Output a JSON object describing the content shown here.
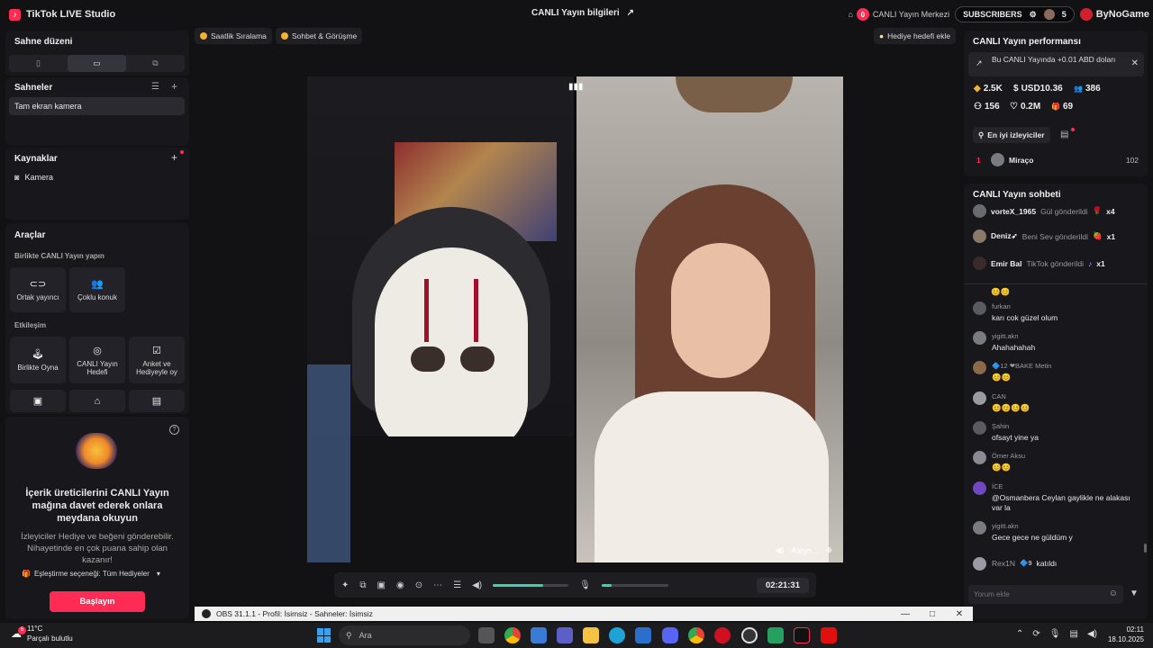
{
  "window": {
    "app_title": "TikTok LIVE Studio",
    "center_title": "CANLI Yayın bilgileri",
    "yayin_merkez": "CANLI Yayın Merkezi",
    "notif_count": "0",
    "subscribers_label": "SUBSCRIBERS",
    "subscribers_count": "5",
    "brand": "ByNoGame"
  },
  "left": {
    "scene_layout_title": "Sahne düzeni",
    "scenes_title": "Sahneler",
    "scene_item": "Tam ekran kamera",
    "sources_title": "Kaynaklar",
    "source_item": "Kamera",
    "tools_title": "Araçlar",
    "collab_title": "Birlikte CANLI Yayın yapın",
    "tools_row1": [
      {
        "icon": "link-icon",
        "glyph": "⊂⊃",
        "label": "Ortak yayıncı"
      },
      {
        "icon": "multi-guest-icon",
        "glyph": "👥",
        "label": "Çoklu konuk"
      }
    ],
    "interaction_title": "Etkileşim",
    "tools_row2": [
      {
        "icon": "joystick-icon",
        "glyph": "🕹",
        "label": "Birlikte Oyna"
      },
      {
        "icon": "goal-icon",
        "glyph": "◎",
        "label": "CANLI Yayın Hedefi"
      },
      {
        "icon": "poll-icon",
        "glyph": "☑",
        "label": "Anket ve Hediyeyle oy"
      }
    ],
    "promo_title": "İçerik üreticilerini CANLI Yayın mağına davet ederek onlara meydana okuyun",
    "promo_text": "İzleyiciler Hediye ve beğeni gönderebilir. Nihayetinde en çok puana sahip olan kazanır!",
    "pairing_label": "Eşleştirme seçeneği: Tüm Hediyeler",
    "start_button": "Başlayın"
  },
  "chips": {
    "hourly": "Saatlik Sıralama",
    "chat_meet": "Sohbet & Görüşme",
    "gift_goal": "Hediye hedefi ekle"
  },
  "video": {
    "right_label": "Aleyn..."
  },
  "controls": {
    "volume_level": 0.67,
    "mic_level": 0.15,
    "timer": "02:21:31"
  },
  "right": {
    "perf_title": "CANLI Yayın performansı",
    "perf_note": "Bu CANLI Yayında +0.01 ABD doları",
    "stats": [
      {
        "icon": "diamond-icon",
        "glyph": "◆",
        "value": "2.5K"
      },
      {
        "icon": "dollar-icon",
        "glyph": "$",
        "value": "USD10.36"
      },
      {
        "icon": "viewers-icon",
        "glyph": "👥",
        "value": "386"
      },
      {
        "icon": "followers-icon",
        "glyph": "⚇",
        "value": "156"
      },
      {
        "icon": "heart-icon",
        "glyph": "♡",
        "value": "0.2M"
      },
      {
        "icon": "gift-icon",
        "glyph": "🎁",
        "value": "69"
      }
    ],
    "top_viewers_tab": "En iyi izleyiciler",
    "top_viewer": {
      "rank": "1",
      "name": "Miraço",
      "score": "102"
    },
    "chat_title": "CANLI Yayın sohbeti",
    "gifts": [
      {
        "user": "vorteX_1965",
        "text": "Gül gönderildi",
        "glyph": "🌹",
        "count": "x4"
      },
      {
        "user": "Deniz➶",
        "text": "Beni Sev gönderildi",
        "glyph": "🍓",
        "count": "x1"
      },
      {
        "user": "Emir Bal",
        "text": "TikTok gönderildi",
        "glyph": "♪",
        "count": "x1"
      }
    ],
    "chat": [
      {
        "user": "",
        "msg": "😊😊"
      },
      {
        "user": "furkan",
        "msg": "karı cok güzel olum"
      },
      {
        "user": "yigitt.akn",
        "msg": "Ahahahahah"
      },
      {
        "user": "🔷12 ❤BAKE Metin",
        "msg": "😊😊"
      },
      {
        "user": "CAN",
        "msg": "😊😊😊😊"
      },
      {
        "user": "Şahin",
        "msg": "ofsayt yine ya"
      },
      {
        "user": "Ömer Aksu",
        "msg": "😊😊"
      },
      {
        "user": "İCE",
        "msg": "@Osmanbera Ceylan gaylikle ne alakası var la"
      },
      {
        "user": "yigitt.akn",
        "msg": "Gece gece ne güldüm y"
      }
    ],
    "join_user": "Rex1N",
    "join_badge": "🔷9",
    "join_text": "katıldı",
    "comment_placeholder": "Yorum ekle"
  },
  "obs": {
    "title": "OBS 31.1.1 - Profil: İsimsiz - Sahneler: İsimsiz"
  },
  "taskbar": {
    "temp": "11°C",
    "weather": "Parçalı bulutlu",
    "search": "Ara",
    "time": "02:11",
    "date": "18.10.2025",
    "weather_badge": "6"
  },
  "colors": {
    "accent": "#fe2c55",
    "slider": "#36d6b0"
  }
}
